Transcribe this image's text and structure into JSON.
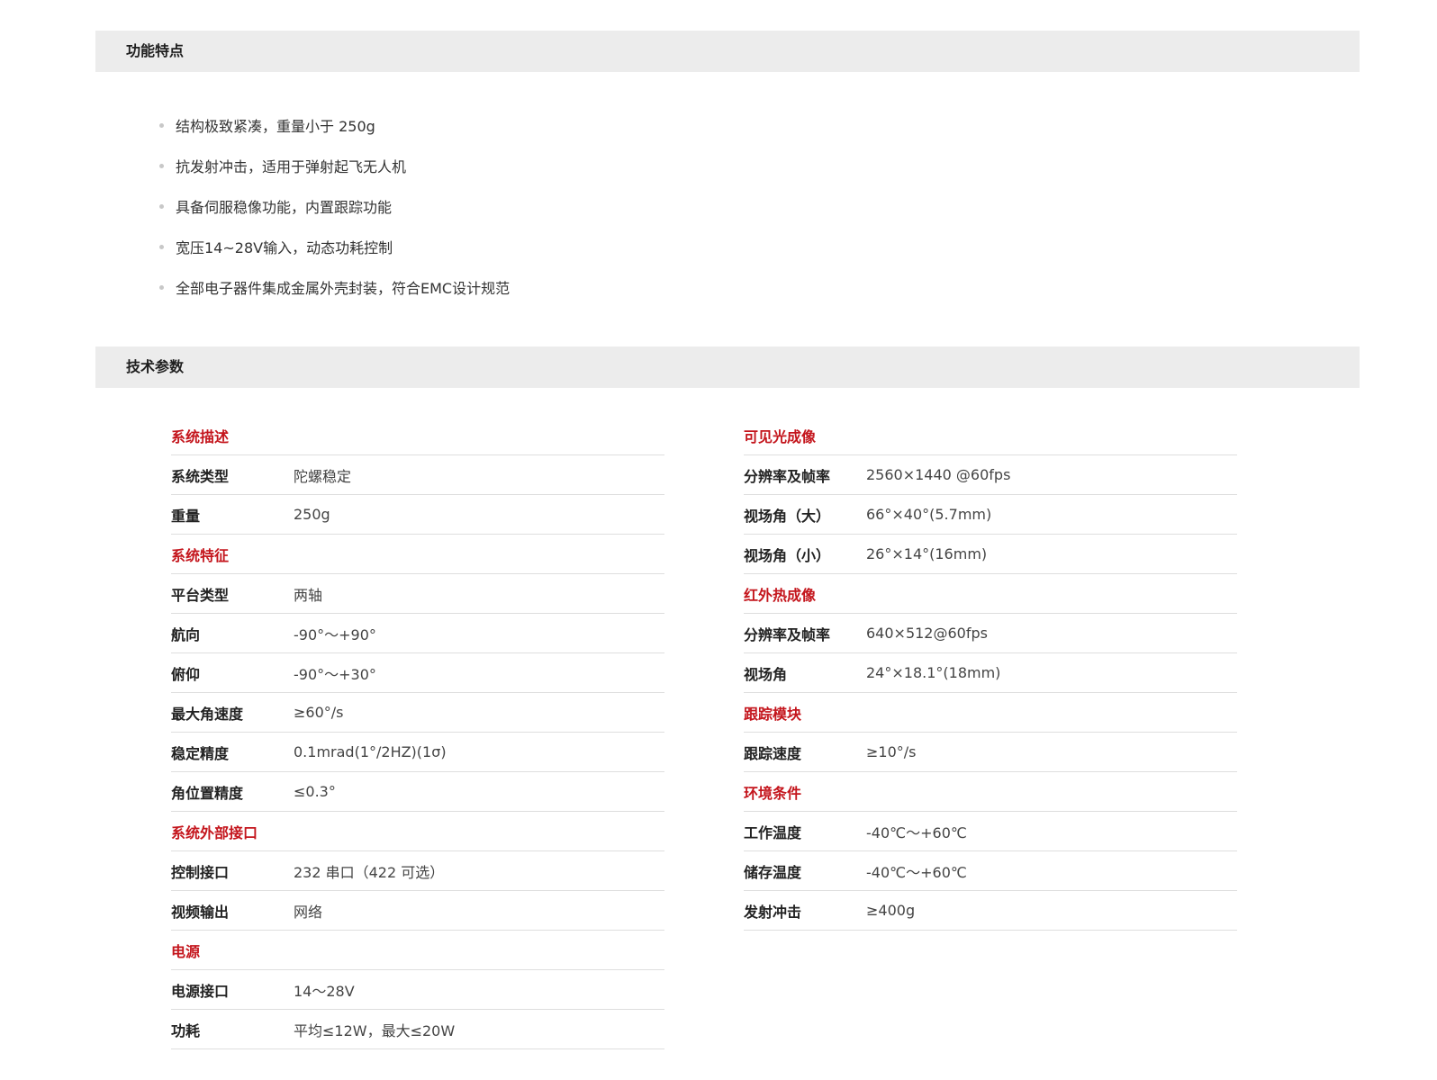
{
  "features": {
    "title": "功能特点",
    "items": [
      "结构极致紧凑，重量小于 250g",
      "抗发射冲击，适用于弹射起飞无人机",
      "具备伺服稳像功能，内置跟踪功能",
      "宽压14~28V输入，动态功耗控制",
      "全部电子器件集成金属外壳封装，符合EMC设计规范"
    ]
  },
  "specs": {
    "title": "技术参数",
    "left": [
      {
        "type": "group",
        "label": "系统描述"
      },
      {
        "type": "row",
        "label": "系统类型",
        "value": "陀螺稳定"
      },
      {
        "type": "row",
        "label": "重量",
        "value": "250g"
      },
      {
        "type": "group",
        "label": "系统特征"
      },
      {
        "type": "row",
        "label": "平台类型",
        "value": "两轴"
      },
      {
        "type": "row",
        "label": "航向",
        "value": "-90°～+90°"
      },
      {
        "type": "row",
        "label": "俯仰",
        "value": "-90°～+30°"
      },
      {
        "type": "row",
        "label": "最大角速度",
        "value": "≥60°/s"
      },
      {
        "type": "row",
        "label": "稳定精度",
        "value": "0.1mrad(1°/2HZ)(1σ)"
      },
      {
        "type": "row",
        "label": "角位置精度",
        "value": "≤0.3°"
      },
      {
        "type": "group",
        "label": "系统外部接口"
      },
      {
        "type": "row",
        "label": "控制接口",
        "value": "232 串口（422 可选）"
      },
      {
        "type": "row",
        "label": "视频输出",
        "value": "网络"
      },
      {
        "type": "group",
        "label": "电源"
      },
      {
        "type": "row",
        "label": "电源接口",
        "value": "14～28V"
      },
      {
        "type": "row",
        "label": "功耗",
        "value": "平均≤12W，最大≤20W"
      }
    ],
    "right": [
      {
        "type": "group",
        "label": "可见光成像"
      },
      {
        "type": "row",
        "label": "分辨率及帧率",
        "value": "2560×1440 @60fps"
      },
      {
        "type": "row",
        "label": "视场角（大）",
        "value": "66°×40°(5.7mm)"
      },
      {
        "type": "row",
        "label": "视场角（小）",
        "value": "26°×14°(16mm)"
      },
      {
        "type": "group",
        "label": "红外热成像"
      },
      {
        "type": "row",
        "label": "分辨率及帧率",
        "value": "640×512@60fps"
      },
      {
        "type": "row",
        "label": "视场角",
        "value": "24°×18.1°(18mm)"
      },
      {
        "type": "group",
        "label": "跟踪模块"
      },
      {
        "type": "row",
        "label": "跟踪速度",
        "value": "≥10°/s"
      },
      {
        "type": "group",
        "label": "环境条件"
      },
      {
        "type": "row",
        "label": "工作温度",
        "value": "-40℃～+60℃"
      },
      {
        "type": "row",
        "label": "储存温度",
        "value": "-40℃～+60℃"
      },
      {
        "type": "row",
        "label": "发射冲击",
        "value": "≥400g"
      }
    ]
  },
  "colors": {
    "group_label": "#c4151c",
    "header_bg": "#ececec",
    "divider": "#dedede"
  }
}
